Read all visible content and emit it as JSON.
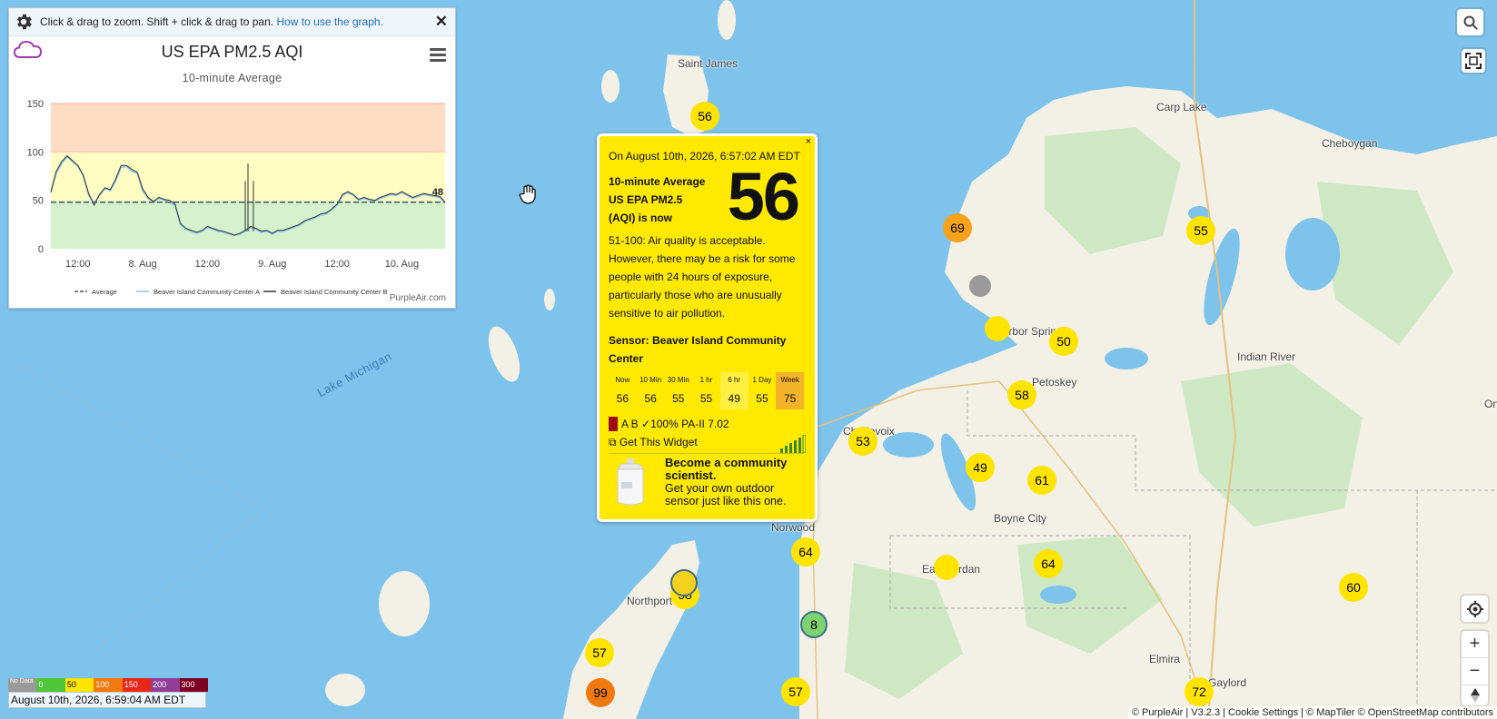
{
  "chart": {
    "hint_prefix": "Click & drag to zoom. Shift + click & drag to pan.",
    "hint_link": "How to use the graph.",
    "close": "✕",
    "title": "US EPA PM2.5 AQI",
    "subtitle": "10-minute Average",
    "credit": "PurpleAir.com"
  },
  "chart_data": {
    "type": "line",
    "title": "US EPA PM2.5 AQI",
    "subtitle": "10-minute Average",
    "y_ticks": [
      0,
      50,
      100,
      150
    ],
    "ylim": [
      0,
      150
    ],
    "x_ticks": [
      "12:00",
      "8. Aug",
      "12:00",
      "9. Aug",
      "12:00",
      "10. Aug"
    ],
    "x_tick_positions_hours": [
      12,
      24,
      36,
      48,
      60,
      72
    ],
    "xlim_hours": [
      7,
      80
    ],
    "bands": [
      {
        "from": 0,
        "to": 50,
        "color": "#d4f3cc"
      },
      {
        "from": 50,
        "to": 100,
        "color": "#fffdc2"
      },
      {
        "from": 100,
        "to": 150,
        "color": "#fddcc3"
      }
    ],
    "average": 48,
    "end_label": "48",
    "series": [
      {
        "name": "Average",
        "style": "dashed",
        "color": "#555555"
      },
      {
        "name": "Beaver Island Community Center A",
        "color": "#89c4ea",
        "x": [
          7,
          8,
          9,
          10,
          11,
          12,
          13,
          14,
          15,
          16,
          17,
          18,
          19,
          20,
          21,
          22,
          23,
          24,
          25,
          26,
          27,
          28,
          29,
          30,
          31,
          32,
          33,
          34,
          35,
          36,
          37,
          38,
          39,
          40,
          41,
          42,
          43,
          44,
          45,
          46,
          47,
          48,
          49,
          50,
          51,
          52,
          53,
          54,
          55,
          56,
          57,
          58,
          59,
          60,
          61,
          62,
          63,
          64,
          65,
          66,
          67,
          68,
          69,
          70,
          71,
          72,
          73,
          74,
          75,
          76,
          77,
          78,
          79,
          80
        ],
        "y": [
          60,
          78,
          88,
          95,
          90,
          85,
          75,
          55,
          47,
          55,
          62,
          60,
          70,
          84,
          85,
          80,
          78,
          60,
          52,
          48,
          52,
          50,
          48,
          45,
          25,
          20,
          18,
          16,
          18,
          22,
          20,
          18,
          17,
          15,
          14,
          15,
          18,
          22,
          20,
          17,
          18,
          15,
          18,
          18,
          20,
          22,
          24,
          28,
          30,
          32,
          35,
          36,
          40,
          45,
          55,
          58,
          55,
          50,
          52,
          50,
          49,
          52,
          54,
          56,
          55,
          58,
          55,
          52,
          54,
          56,
          55,
          54,
          53,
          48
        ]
      },
      {
        "name": "Beaver Island Community Center B",
        "color": "#333333",
        "x": [
          7,
          8,
          9,
          10,
          11,
          12,
          13,
          14,
          15,
          16,
          17,
          18,
          19,
          20,
          21,
          22,
          23,
          24,
          25,
          26,
          27,
          28,
          29,
          30,
          31,
          32,
          33,
          34,
          35,
          36,
          37,
          38,
          39,
          40,
          41,
          42,
          43,
          44,
          45,
          46,
          47,
          48,
          49,
          50,
          51,
          52,
          53,
          54,
          55,
          56,
          57,
          58,
          59,
          60,
          61,
          62,
          63,
          64,
          65,
          66,
          67,
          68,
          69,
          70,
          71,
          72,
          73,
          74,
          75,
          76,
          77,
          78,
          79,
          80
        ],
        "y": [
          58,
          80,
          90,
          96,
          91,
          86,
          76,
          57,
          45,
          56,
          63,
          61,
          72,
          86,
          86,
          82,
          79,
          62,
          53,
          49,
          53,
          51,
          50,
          46,
          26,
          21,
          19,
          17,
          19,
          23,
          21,
          19,
          18,
          16,
          14,
          16,
          19,
          23,
          21,
          18,
          19,
          16,
          19,
          19,
          21,
          23,
          25,
          29,
          31,
          33,
          36,
          37,
          41,
          46,
          56,
          59,
          56,
          51,
          53,
          51,
          50,
          53,
          55,
          57,
          56,
          59,
          56,
          53,
          55,
          57,
          56,
          55,
          54,
          48
        ]
      }
    ],
    "spikes_hours": [
      43,
      43.5,
      44.5
    ]
  },
  "popup": {
    "close": "×",
    "datetime": "On August 10th, 2026, 6:57:02 AM EDT",
    "label1": "10-minute Average",
    "label2": "US EPA PM2.5",
    "label3": "(AQI) is now",
    "value": "56",
    "description": "51-100: Air quality is acceptable. However, there may be a risk for some people with 24 hours of exposure, particularly those who are unusually sensitive to air pollution.",
    "sensor": "Sensor: Beaver Island Community Center",
    "history": [
      {
        "h": "Now",
        "v": "56"
      },
      {
        "h": "10 Min",
        "v": "56"
      },
      {
        "h": "30 Min",
        "v": "55"
      },
      {
        "h": "1 hr",
        "v": "55"
      },
      {
        "h": "6 hr",
        "v": "49"
      },
      {
        "h": "1 Day",
        "v": "55"
      },
      {
        "h": "Week",
        "v": "75"
      }
    ],
    "status": "A B ✓100% PA-II 7.02",
    "widget": "Get This Widget",
    "promo_title": "Become a community scientist.",
    "promo_text": "Get your own outdoor sensor just like this one."
  },
  "map": {
    "lake_label": "Lake Michigan",
    "places": [
      "Saint James",
      "Carp Lake",
      "Cheboygan",
      "Harbor Springs",
      "Petoskey",
      "Indian River",
      "Charlevoix",
      "Boyne City",
      "Norwood",
      "East Jordan",
      "Northport",
      "Elmira",
      "Gaylord",
      "On"
    ],
    "markers": [
      "56",
      "69",
      "55",
      "50",
      "58",
      "53",
      "49",
      "61",
      "64",
      "64",
      "58",
      "8",
      "57",
      "99",
      "57",
      "72",
      "60"
    ]
  },
  "legend": {
    "labels": [
      "No Data",
      "0",
      "50",
      "100",
      "150",
      "200",
      "300"
    ],
    "colors": [
      "#9a9a9a",
      "#4fc53a",
      "#ffe400",
      "#f47a10",
      "#e8261a",
      "#8f3f97",
      "#7e0023"
    ],
    "time": "August 10th, 2026, 6:59:04 AM EDT"
  },
  "attribution": "© PurpleAir | V3.2.3 | Cookie Settings | © MapTiler © OpenStreetMap contributors",
  "controls": {
    "plus": "+",
    "minus": "−"
  }
}
